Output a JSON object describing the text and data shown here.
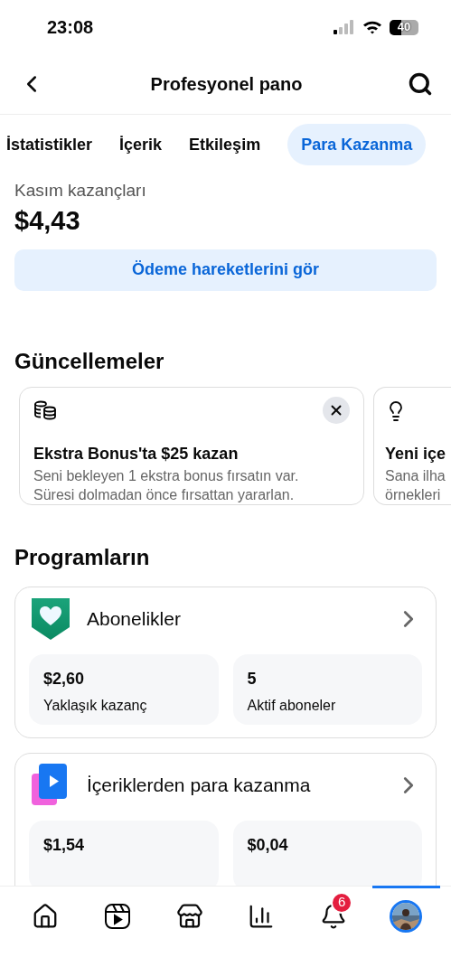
{
  "status_bar": {
    "time": "23:08",
    "battery": "40"
  },
  "header": {
    "title": "Profesyonel pano"
  },
  "tabs": [
    {
      "label": "İstatistikler",
      "selected": false
    },
    {
      "label": "İçerik",
      "selected": false
    },
    {
      "label": "Etkileşim",
      "selected": false
    },
    {
      "label": "Para Kazanma",
      "selected": true
    }
  ],
  "earnings": {
    "label": "Kasım kazançları",
    "amount": "$4,43",
    "button": "Ödeme hareketlerini gör"
  },
  "updates": {
    "title": "Güncellemeler",
    "cards": [
      {
        "kind": "coins",
        "title": "Ekstra Bonus'ta $25 kazan",
        "lines": [
          "Seni bekleyen 1 ekstra bonus fırsatın var.",
          "Süresi dolmadan önce fırsattan yararlan."
        ],
        "dismissible": true
      },
      {
        "kind": "bulb",
        "title": "Yeni içe",
        "lines": [
          "Sana ilha",
          "örnekleri"
        ],
        "dismissible": false
      }
    ]
  },
  "programs": {
    "title": "Programların",
    "items": [
      {
        "kind": "subscriptions",
        "name": "Abonelikler",
        "stats": [
          {
            "value": "$2,60",
            "label": "Yaklaşık kazanç"
          },
          {
            "value": "5",
            "label": "Aktif aboneler"
          }
        ]
      },
      {
        "kind": "content",
        "name": "İçeriklerden para kazanma",
        "stats": [
          {
            "value": "$1,54"
          },
          {
            "value": "$0,04"
          }
        ]
      }
    ]
  },
  "nav": [
    {
      "kind": "home",
      "selected": false
    },
    {
      "kind": "reels",
      "selected": false
    },
    {
      "kind": "shop",
      "selected": false
    },
    {
      "kind": "insights",
      "selected": false
    },
    {
      "kind": "notifications",
      "selected": false,
      "badge": "6"
    },
    {
      "kind": "profile",
      "selected": true
    }
  ]
}
